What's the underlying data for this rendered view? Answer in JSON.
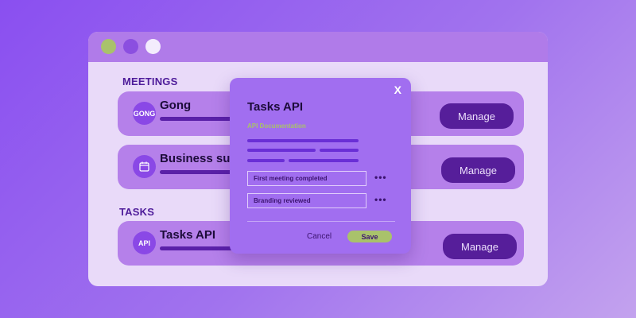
{
  "colors": {
    "background": "#9a5ff1",
    "accent": "#561e9a",
    "highlight": "#a9c26b"
  },
  "window": {
    "controls": [
      "green-dot",
      "purple-dot",
      "white-dot"
    ]
  },
  "meetings": {
    "label": "MEETINGS",
    "items": [
      {
        "title": "Gong",
        "icon_text": "GONG",
        "icon": "gong-logo",
        "action": "Manage"
      },
      {
        "title": "Business suite",
        "icon": "calendar-icon",
        "action": "Manage"
      }
    ]
  },
  "tasks": {
    "label": "TASKS",
    "items": [
      {
        "title": "Tasks API",
        "icon_text": "API",
        "icon": "api-icon",
        "action": "Manage"
      }
    ]
  },
  "modal": {
    "close": "X",
    "title": "Tasks API",
    "subtitle": "API Documentation",
    "items": [
      {
        "label": "First meeting completed",
        "more": "•••"
      },
      {
        "label": "Branding reviewed",
        "more": "•••"
      }
    ],
    "cancel": "Cancel",
    "save": "Save"
  }
}
